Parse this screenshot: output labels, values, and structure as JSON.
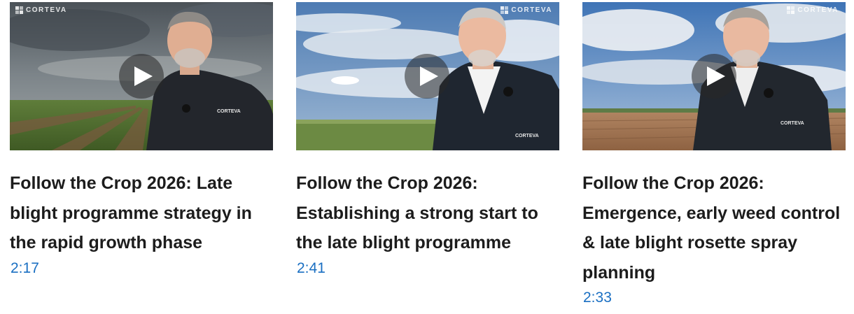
{
  "brand": {
    "logo_text": "CORTEVA",
    "shirt_text": "CORTEVA"
  },
  "colors": {
    "duration": "#1a6fc2",
    "title": "#1c1c1c",
    "play_overlay": "#282828"
  },
  "play_icon": "play-icon",
  "videos": [
    {
      "title": "Follow the Crop 2026: Late blight programme strategy in the rapid growth phase",
      "duration": "2:17"
    },
    {
      "title": "Follow the Crop 2026: Establishing a strong start to the late blight programme",
      "duration": "2:41"
    },
    {
      "title": "Follow the Crop 2026: Emergence, early weed control & late blight rosette spray planning",
      "duration": "2:33"
    }
  ]
}
